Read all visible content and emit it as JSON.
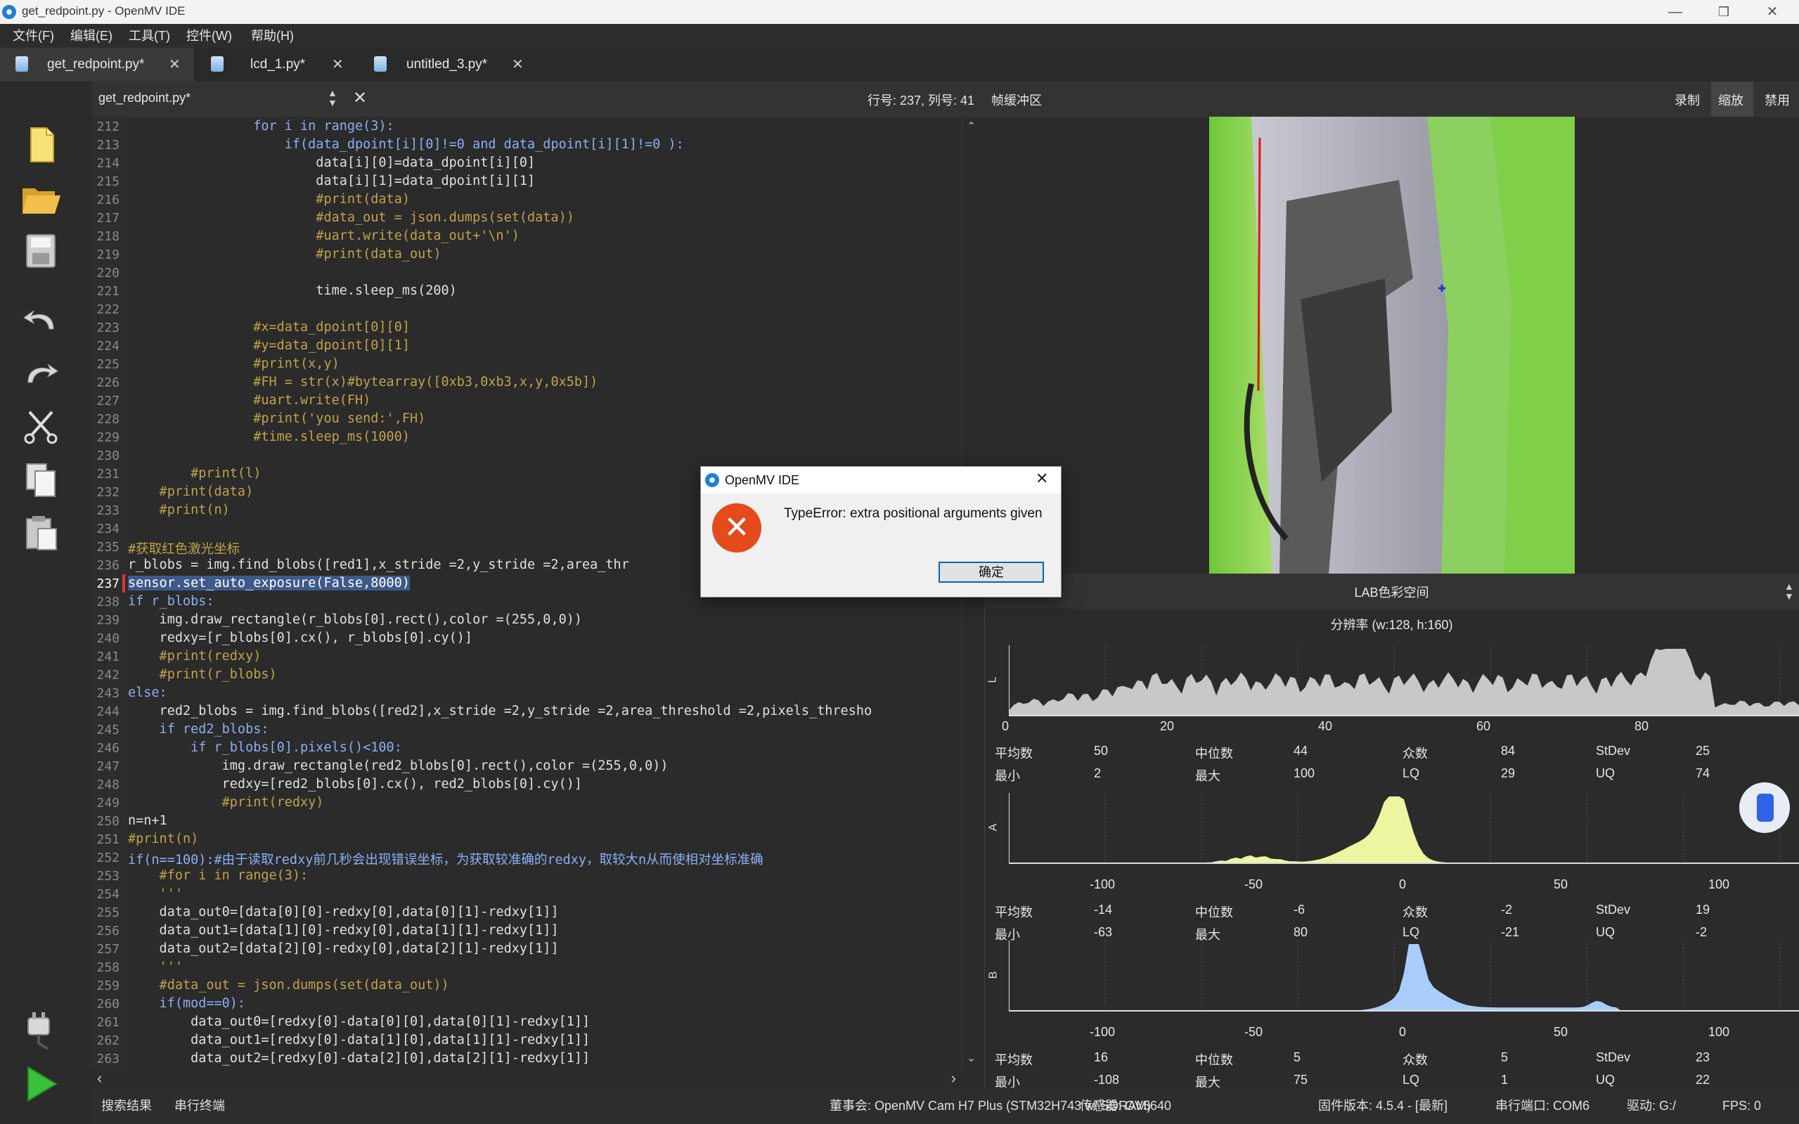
{
  "window": {
    "title": "get_redpoint.py - OpenMV IDE"
  },
  "menu": [
    "文件(F)",
    "编辑(E)",
    "工具(T)",
    "控件(W)",
    "帮助(H)"
  ],
  "tabs": [
    {
      "label": "get_redpoint.py*"
    },
    {
      "label": "lcd_1.py*"
    },
    {
      "label": "untitled_3.py*"
    }
  ],
  "editor": {
    "file_label": "get_redpoint.py*",
    "position": "行号: 237, 列号: 41",
    "lines": [
      {
        "n": "212",
        "t": "                for i in range(3):"
      },
      {
        "n": "213",
        "t": "                    if(data_dpoint[i][0]!=0 and data_dpoint[i][1]!=0 ):"
      },
      {
        "n": "214",
        "t": "                        data[i][0]=data_dpoint[i][0]"
      },
      {
        "n": "215",
        "t": "                        data[i][1]=data_dpoint[i][1]"
      },
      {
        "n": "216",
        "t": "                        #print(data)"
      },
      {
        "n": "217",
        "t": "                        #data_out = json.dumps(set(data))"
      },
      {
        "n": "218",
        "t": "                        #uart.write(data_out+'\\n')"
      },
      {
        "n": "219",
        "t": "                        #print(data_out)"
      },
      {
        "n": "220",
        "t": ""
      },
      {
        "n": "221",
        "t": "                        time.sleep_ms(200)"
      },
      {
        "n": "222",
        "t": ""
      },
      {
        "n": "223",
        "t": "                #x=data_dpoint[0][0]"
      },
      {
        "n": "224",
        "t": "                #y=data_dpoint[0][1]"
      },
      {
        "n": "225",
        "t": "                #print(x,y)"
      },
      {
        "n": "226",
        "t": "                #FH = str(x)#bytearray([0xb3,0xb3,x,y,0x5b])"
      },
      {
        "n": "227",
        "t": "                #uart.write(FH)"
      },
      {
        "n": "228",
        "t": "                #print('you send:',FH)"
      },
      {
        "n": "229",
        "t": "                #time.sleep_ms(1000)"
      },
      {
        "n": "230",
        "t": ""
      },
      {
        "n": "231",
        "t": "        #print(l)"
      },
      {
        "n": "232",
        "t": "    #print(data)"
      },
      {
        "n": "233",
        "t": "    #print(n)"
      },
      {
        "n": "234",
        "t": ""
      },
      {
        "n": "235",
        "t": "#获取红色激光坐标"
      },
      {
        "n": "236",
        "t": "r_blobs = img.find_blobs([red1],x_stride =2,y_stride =2,area_thr"
      },
      {
        "n": "237",
        "t": "sensor.set_auto_exposure(False,8000)"
      },
      {
        "n": "238",
        "t": "if r_blobs:"
      },
      {
        "n": "239",
        "t": "    img.draw_rectangle(r_blobs[0].rect(),color =(255,0,0))"
      },
      {
        "n": "240",
        "t": "    redxy=[r_blobs[0].cx(), r_blobs[0].cy()]"
      },
      {
        "n": "241",
        "t": "    #print(redxy)"
      },
      {
        "n": "242",
        "t": "    #print(r_blobs)"
      },
      {
        "n": "243",
        "t": "else:"
      },
      {
        "n": "244",
        "t": "    red2_blobs = img.find_blobs([red2],x_stride =2,y_stride =2,area_threshold =2,pixels_thresho"
      },
      {
        "n": "245",
        "t": "    if red2_blobs:"
      },
      {
        "n": "246",
        "t": "        if r_blobs[0].pixels()<100:"
      },
      {
        "n": "247",
        "t": "            img.draw_rectangle(red2_blobs[0].rect(),color =(255,0,0))"
      },
      {
        "n": "248",
        "t": "            redxy=[red2_blobs[0].cx(), red2_blobs[0].cy()]"
      },
      {
        "n": "249",
        "t": "            #print(redxy)"
      },
      {
        "n": "250",
        "t": "n=n+1"
      },
      {
        "n": "251",
        "t": "#print(n)"
      },
      {
        "n": "252",
        "t": "if(n==100):#由于读取redxy前几秒会出现错误坐标，为获取较准确的redxy，取较大n从而使相对坐标准确"
      },
      {
        "n": "253",
        "t": "    #for i in range(3):"
      },
      {
        "n": "254",
        "t": "    '''"
      },
      {
        "n": "255",
        "t": "    data_out0=[data[0][0]-redxy[0],data[0][1]-redxy[1]]"
      },
      {
        "n": "256",
        "t": "    data_out1=[data[1][0]-redxy[0],data[1][1]-redxy[1]]"
      },
      {
        "n": "257",
        "t": "    data_out2=[data[2][0]-redxy[0],data[2][1]-redxy[1]]"
      },
      {
        "n": "258",
        "t": "    '''"
      },
      {
        "n": "259",
        "t": "    #data_out = json.dumps(set(data_out))"
      },
      {
        "n": "260",
        "t": "    if(mod==0):"
      },
      {
        "n": "261",
        "t": "        data_out0=[redxy[0]-data[0][0],data[0][1]-redxy[1]]"
      },
      {
        "n": "262",
        "t": "        data_out1=[redxy[0]-data[1][0],data[1][1]-redxy[1]]"
      },
      {
        "n": "263",
        "t": "        data_out2=[redxy[0]-data[2][0],data[2][1]-redxy[1]]"
      }
    ]
  },
  "framebuffer": {
    "title": "帧缓冲区",
    "buttons": [
      "录制",
      "缩放",
      "禁用"
    ]
  },
  "histogram": {
    "color_space": "LAB色彩空间",
    "resolution": "分辨率 (w:128, h:160)",
    "channels": [
      {
        "name": "L",
        "ticks": [
          "0",
          "20",
          "40",
          "60",
          "80"
        ],
        "stats1": {
          "mean_label": "平均数",
          "mean": "50",
          "median_label": "中位数",
          "median": "44",
          "mode_label": "众数",
          "mode": "84",
          "stdev_label": "StDev",
          "stdev": "25"
        },
        "stats2": {
          "min_label": "最小",
          "min": "2",
          "max_label": "最大",
          "max": "100",
          "lq_label": "LQ",
          "lq": "29",
          "uq_label": "UQ",
          "uq": "74"
        },
        "color": "#c8c8c8"
      },
      {
        "name": "A",
        "ticks": [
          "-100",
          "-50",
          "0",
          "50",
          "100"
        ],
        "stats1": {
          "mean_label": "平均数",
          "mean": "-14",
          "median_label": "中位数",
          "median": "-6",
          "mode_label": "众数",
          "mode": "-2",
          "stdev_label": "StDev",
          "stdev": "19"
        },
        "stats2": {
          "min_label": "最小",
          "min": "-63",
          "max_label": "最大",
          "max": "80",
          "lq_label": "LQ",
          "lq": "-21",
          "uq_label": "UQ",
          "uq": "-2"
        },
        "color": "#eef5a0"
      },
      {
        "name": "B",
        "ticks": [
          "-100",
          "-50",
          "0",
          "50",
          "100"
        ],
        "stats1": {
          "mean_label": "平均数",
          "mean": "16",
          "median_label": "中位数",
          "median": "5",
          "mode_label": "众数",
          "mode": "5",
          "stdev_label": "StDev",
          "stdev": "23"
        },
        "stats2": {
          "min_label": "最小",
          "min": "-108",
          "max_label": "最大",
          "max": "75",
          "lq_label": "LQ",
          "lq": "1",
          "uq_label": "UQ",
          "uq": "22"
        },
        "color": "#a8cdfa"
      }
    ]
  },
  "dialog": {
    "title": "OpenMV IDE",
    "message": "TypeError: extra positional arguments given",
    "ok": "确定"
  },
  "bottom": {
    "search_results": "搜索结果",
    "serial_terminal": "串行终端",
    "board": "董事会: OpenMV Cam H7 Plus (STM32H743 w/ SDRAM)",
    "sensor": "传感器: OV5640",
    "firmware": "固件版本: 4.5.4 - [最新]",
    "port": "串行端口: COM6",
    "drive": "驱动: G:/",
    "fps": "FPS: 0"
  }
}
